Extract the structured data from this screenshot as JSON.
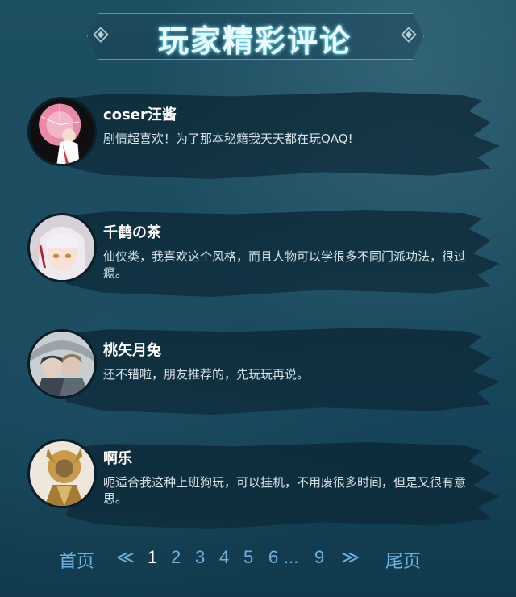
{
  "header": {
    "title": "玩家精彩评论"
  },
  "comments": [
    {
      "name": "coser汪酱",
      "text": "剧情超喜欢！为了那本秘籍我天天都在玩QAQ!"
    },
    {
      "name": "千鹤の茶",
      "text": "仙侠类，我喜欢这个风格，而且人物可以学很多不同门派功法，很过瘾。"
    },
    {
      "name": "桃矢月兔",
      "text": "还不错啦，朋友推荐的，先玩玩再说。"
    },
    {
      "name": "啊乐",
      "text": "呃适合我这种上班狗玩，可以挂机，不用废很多时间，但是又很有意思。"
    }
  ],
  "pagination": {
    "first": "首页",
    "prev": "≪",
    "pages": [
      "1",
      "2",
      "3",
      "4",
      "5",
      "6"
    ],
    "ellipsis": "...",
    "last_page": "9",
    "next": "≫",
    "last": "尾页",
    "current": "1"
  },
  "colors": {
    "accent": "#6fb2e0",
    "title_glow": "#78e6ff"
  }
}
